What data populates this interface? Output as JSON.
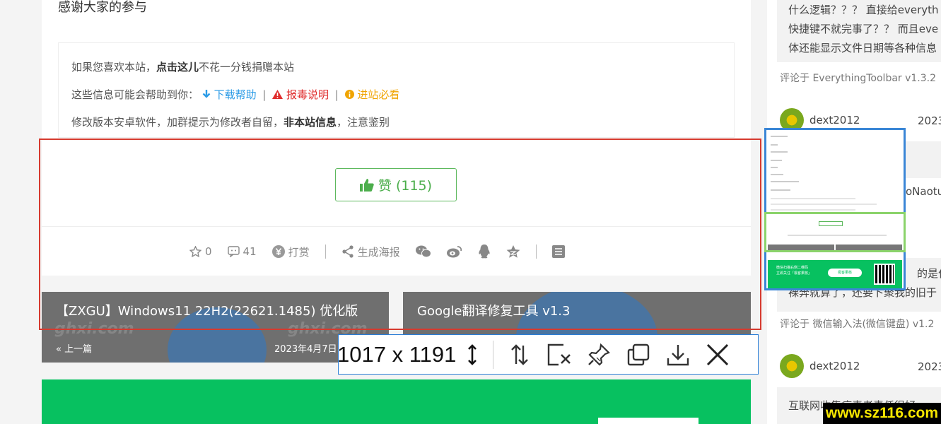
{
  "article": {
    "thanks": "感谢大家的参与",
    "info": {
      "line1_prefix": "如果您喜欢本站，",
      "line1_link": "点击这儿",
      "line1_suffix": "不花一分钱捐赠本站",
      "line2_prefix": "这些信息可能会帮助到你：",
      "download_help": "下载帮助",
      "report_note": "报毒说明",
      "must_read": "进站必看",
      "separator": "|",
      "line3_prefix": "修改版本安卓软件，加群提示为修改者自留，",
      "line3_bold": "非本站信息",
      "line3_suffix": "，注意鉴别"
    },
    "like_label": "赞 (115)",
    "actions": {
      "star_count": "0",
      "comment_count": "41",
      "reward": "打赏",
      "poster": "生成海报"
    },
    "prev": {
      "title": "【ZXGU】Windows11 22H2(22621.1485) 优化版",
      "label": "上一篇",
      "date": "2023年4月7日"
    },
    "next": {
      "title": "Google翻译修复工具 v1.3"
    },
    "watermark": "ghxi.com"
  },
  "toolbar": {
    "dimensions": "1017 x 1191"
  },
  "sidebar": {
    "comment1": [
      "什么逻辑？？？ 直接给everyth",
      "快捷键不就完事了？？ 而且eve",
      "体还能显示文件日期等各种信息"
    ],
    "meta1": "评论于 EverythingToolbar v1.3.2",
    "user1": "dext2012",
    "date1": "2023",
    "partial1": "oNaotu",
    "comment2": [
      "的是什么",
      "裸奔就算了，还要卜聚我的旧于"
    ],
    "meta2": "评论于 微信输入法(微信键盘) v1.2",
    "user2": "dext2012",
    "date2": "2023",
    "comment3": "互联网收集病毒者责任很好"
  },
  "thumbnail": {
    "banner_line1": "微信扫描右侧二维码",
    "banner_line2": "立即关注「极客果核」",
    "banner_button": "极客果核"
  },
  "site_mark": "www.sz116.com",
  "colors": {
    "like_green": "#4cae4c",
    "banner_green": "#07c160",
    "selection_red": "#d63a2f",
    "toolbar_blue": "#2a7dd6",
    "download_blue": "#2b9be6",
    "warning_red": "#e02d2d",
    "info_yellow": "#f0a400"
  }
}
